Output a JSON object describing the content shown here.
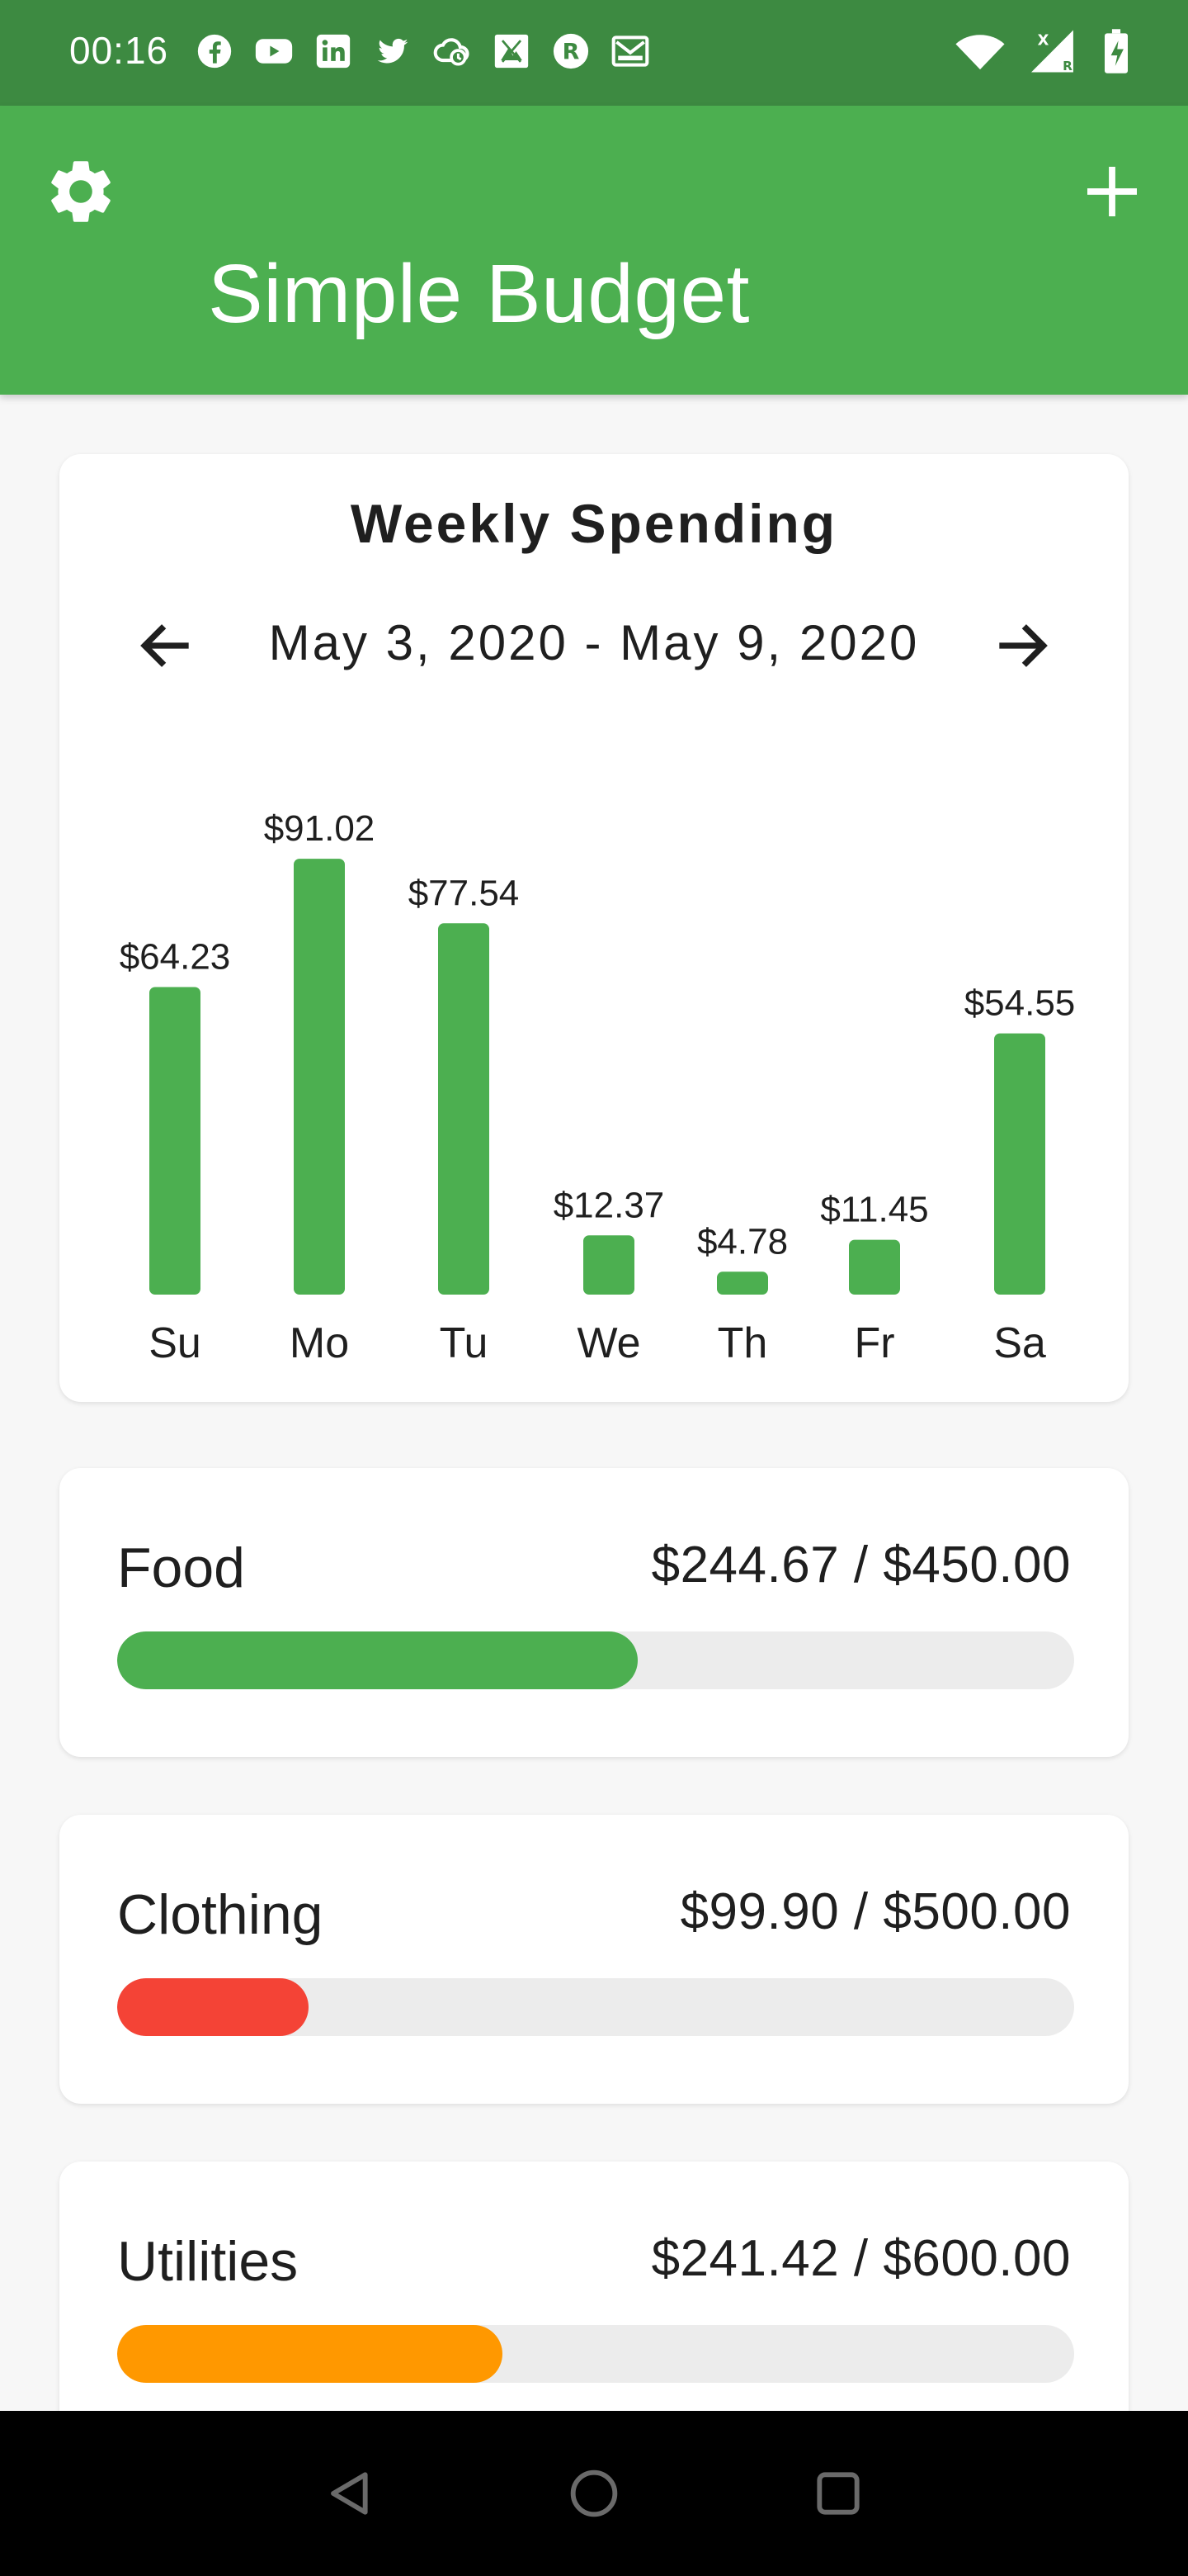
{
  "status_bar": {
    "time": "00:16",
    "left_icons": [
      "facebook-icon",
      "youtube-icon",
      "linkedin-icon",
      "twitter-icon",
      "cloud-icon",
      "image-icon",
      "r-badge-icon",
      "mail-icon"
    ],
    "right_icons": [
      "wifi-icon",
      "signal-icon",
      "battery-icon"
    ]
  },
  "app_bar": {
    "title": "Simple Budget",
    "settings_icon": "gear-icon",
    "add_icon": "plus-icon",
    "background": "#4caf50"
  },
  "weekly_spending": {
    "title": "Weekly Spending",
    "range": "May 3, 2020 - May 9, 2020",
    "prev_icon": "arrow-left-icon",
    "next_icon": "arrow-right-icon"
  },
  "chart_data": {
    "type": "bar",
    "categories": [
      "Su",
      "Mo",
      "Tu",
      "We",
      "Th",
      "Fr",
      "Sa"
    ],
    "values": [
      64.23,
      91.02,
      77.54,
      12.37,
      4.78,
      11.45,
      54.55
    ],
    "value_labels": [
      "$64.23",
      "$91.02",
      "$77.54",
      "$12.37",
      "$4.78",
      "$11.45",
      "$54.55"
    ],
    "color": "#4caf50",
    "grid": false
  },
  "budgets": [
    {
      "name": "Food",
      "amount": "$244.67 / $450.00",
      "fraction": 0.5437,
      "color": "#4caf50"
    },
    {
      "name": "Clothing",
      "amount": "$99.90 / $500.00",
      "fraction": 0.1998,
      "color": "#f44336"
    },
    {
      "name": "Utilities",
      "amount": "$241.42 / $600.00",
      "fraction": 0.4024,
      "color": "#ff9800"
    }
  ],
  "nav_bar": {
    "icons": [
      "back-icon",
      "home-icon",
      "recents-icon"
    ]
  }
}
